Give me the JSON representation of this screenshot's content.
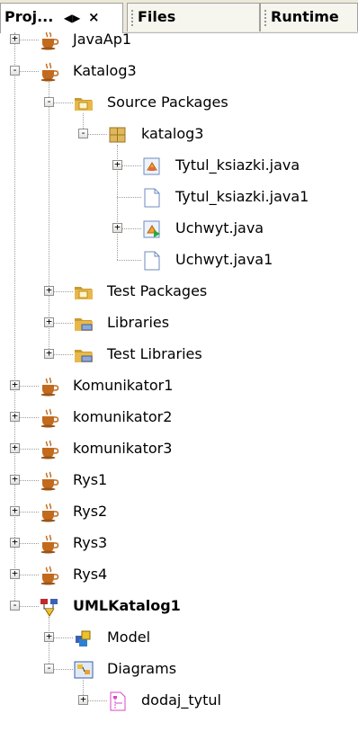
{
  "tabs": [
    {
      "label": "Proj...",
      "controls": "◀▶",
      "close": "×",
      "active": true
    },
    {
      "label": "Files",
      "active": false
    },
    {
      "label": "Runtime",
      "active": false
    }
  ],
  "tree": [
    {
      "label": "JavaAp1",
      "icon": "java-project-icon",
      "level": 0,
      "expander": "+"
    },
    {
      "label": "Katalog3",
      "icon": "java-project-icon",
      "level": 0,
      "expander": "-"
    },
    {
      "label": "Source Packages",
      "icon": "source-folder-icon",
      "level": 1,
      "expander": "-"
    },
    {
      "label": "katalog3",
      "icon": "package-icon",
      "level": 2,
      "expander": "-"
    },
    {
      "label": "Tytul_ksiazki.java",
      "icon": "java-class-icon",
      "level": 3,
      "expander": "+"
    },
    {
      "label": "Tytul_ksiazki.java1",
      "icon": "file-icon",
      "level": 3,
      "expander": ""
    },
    {
      "label": "Uchwyt.java",
      "icon": "java-main-class-icon",
      "level": 3,
      "expander": "+"
    },
    {
      "label": "Uchwyt.java1",
      "icon": "file-icon",
      "level": 3,
      "expander": ""
    },
    {
      "label": "Test Packages",
      "icon": "source-folder-icon",
      "level": 1,
      "expander": "+"
    },
    {
      "label": "Libraries",
      "icon": "library-folder-icon",
      "level": 1,
      "expander": "+"
    },
    {
      "label": "Test Libraries",
      "icon": "library-folder-icon",
      "level": 1,
      "expander": "+"
    },
    {
      "label": "Komunikator1",
      "icon": "java-project-icon",
      "level": 0,
      "expander": "+"
    },
    {
      "label": "komunikator2",
      "icon": "java-project-icon",
      "level": 0,
      "expander": "+"
    },
    {
      "label": "komunikator3",
      "icon": "java-project-icon",
      "level": 0,
      "expander": "+"
    },
    {
      "label": "Rys1",
      "icon": "java-project-icon",
      "level": 0,
      "expander": "+"
    },
    {
      "label": "Rys2",
      "icon": "java-project-icon",
      "level": 0,
      "expander": "+"
    },
    {
      "label": "Rys3",
      "icon": "java-project-icon",
      "level": 0,
      "expander": "+"
    },
    {
      "label": "Rys4",
      "icon": "java-project-icon",
      "level": 0,
      "expander": "+"
    },
    {
      "label": "UMLKatalog1",
      "icon": "uml-project-icon",
      "level": 0,
      "expander": "-",
      "bold": true
    },
    {
      "label": "Model",
      "icon": "model-icon",
      "level": 1,
      "expander": "+"
    },
    {
      "label": "Diagrams",
      "icon": "diagrams-icon",
      "level": 1,
      "expander": "-"
    },
    {
      "label": "dodaj_tytul",
      "icon": "sequence-diagram-icon",
      "level": 2,
      "expander": "+"
    }
  ],
  "colors": {
    "folder": "#e8b94a",
    "cup": "#c26a1e",
    "uml": "#c0282b",
    "diagram": "#d946c4"
  }
}
